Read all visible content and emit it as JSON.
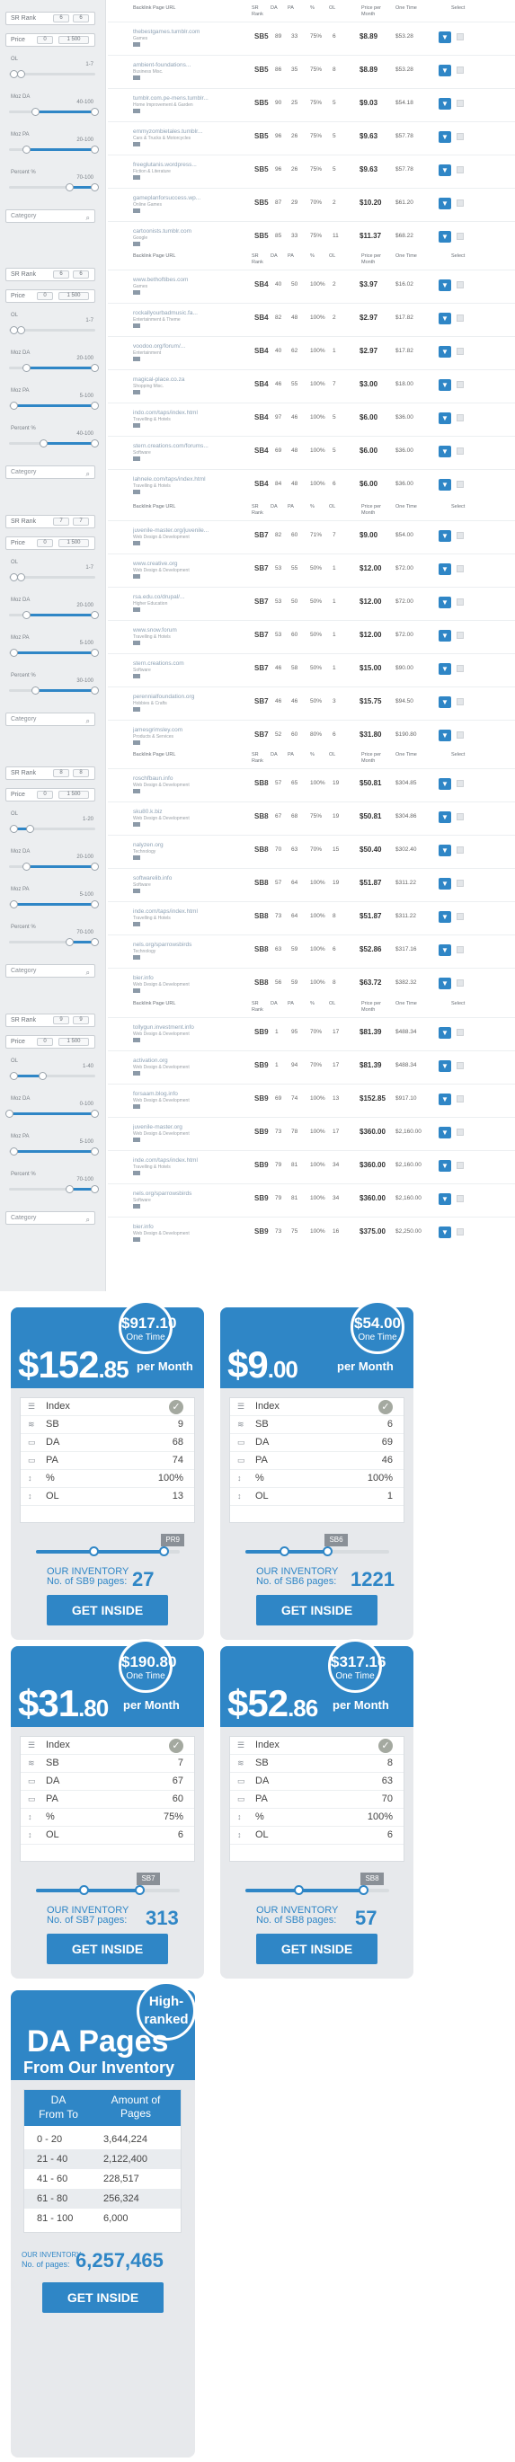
{
  "filters": {
    "sr_rank_label": "SR Rank",
    "price_label": "Price",
    "category_placeholder": "Category",
    "blocks": [
      {
        "sr_from": "6",
        "sr_to": "6",
        "price_from": "0",
        "price_to": "1 500",
        "ol": "1-7",
        "ol_min": 0.05,
        "ol_max": 0.15,
        "moz_da": "40-100",
        "moz_da_min": 0.3,
        "moz_da_max": 1.0,
        "moz_pa": "20-100",
        "moz_pa_min": 0.2,
        "moz_pa_max": 1.0,
        "percent": "70-100",
        "percent_min": 0.7,
        "percent_max": 1.0
      },
      {
        "sr_from": "6",
        "sr_to": "6",
        "price_from": "0",
        "price_to": "1 500",
        "ol": "1-7",
        "ol_min": 0.05,
        "ol_max": 0.15,
        "moz_da": "20-100",
        "moz_da_min": 0.2,
        "moz_da_max": 1.0,
        "moz_pa": "5-100",
        "moz_pa_min": 0.05,
        "moz_pa_max": 1.0,
        "percent": "40-100",
        "percent_min": 0.4,
        "percent_max": 1.0
      },
      {
        "sr_from": "7",
        "sr_to": "7",
        "price_from": "0",
        "price_to": "1 500",
        "ol": "1-7",
        "ol_min": 0.05,
        "ol_max": 0.15,
        "moz_da": "20-100",
        "moz_da_min": 0.2,
        "moz_da_max": 1.0,
        "moz_pa": "5-100",
        "moz_pa_min": 0.05,
        "moz_pa_max": 1.0,
        "percent": "30-100",
        "percent_min": 0.3,
        "percent_max": 1.0
      },
      {
        "sr_from": "8",
        "sr_to": "8",
        "price_from": "0",
        "price_to": "1 500",
        "ol": "1-20",
        "ol_min": 0.05,
        "ol_max": 0.25,
        "moz_da": "20-100",
        "moz_da_min": 0.2,
        "moz_da_max": 1.0,
        "moz_pa": "5-100",
        "moz_pa_min": 0.05,
        "moz_pa_max": 1.0,
        "percent": "70-100",
        "percent_min": 0.7,
        "percent_max": 1.0
      },
      {
        "sr_from": "9",
        "sr_to": "9",
        "price_from": "0",
        "price_to": "1 500",
        "ol": "1-40",
        "ol_min": 0.05,
        "ol_max": 0.4,
        "moz_da": "0-100",
        "moz_da_min": 0.0,
        "moz_da_max": 1.0,
        "moz_pa": "5-100",
        "moz_pa_min": 0.05,
        "moz_pa_max": 1.0,
        "percent": "70-100",
        "percent_min": 0.7,
        "percent_max": 1.0
      }
    ]
  },
  "table_header": {
    "page": "Backlink Page URL",
    "sr": "SR Rank",
    "da": "DA",
    "pa": "PA",
    "pct": "%",
    "ol": "OL",
    "price": "Price per Month",
    "one_time": "One Time",
    "select": "Select"
  },
  "tables": [
    {
      "rows": [
        {
          "site": "thebestgames.tumblr.com",
          "cat": "Games",
          "sr": "SB5",
          "da": "89",
          "pa": "33",
          "pct": "75%",
          "ol": "6",
          "pm": "$8.89",
          "ot": "$53.28"
        },
        {
          "site": "ambient-foundations...",
          "cat": "Business Misc.",
          "sr": "SB5",
          "da": "86",
          "pa": "35",
          "pct": "75%",
          "ol": "8",
          "pm": "$8.89",
          "ot": "$53.28"
        },
        {
          "site": "tumblr.com.pe-mens.tumblr...",
          "cat": "Home Improvement & Garden",
          "sr": "SB5",
          "da": "90",
          "pa": "25",
          "pct": "75%",
          "ol": "5",
          "pm": "$9.03",
          "ot": "$54.18"
        },
        {
          "site": "emmyzombietales.tumblr...",
          "cat": "Cars & Trucks & Motorcycles",
          "sr": "SB5",
          "da": "96",
          "pa": "26",
          "pct": "75%",
          "ol": "5",
          "pm": "$9.63",
          "ot": "$57.78"
        },
        {
          "site": "freeglutanis.wordpress...",
          "cat": "Fiction & Literature",
          "sr": "SB5",
          "da": "96",
          "pa": "26",
          "pct": "75%",
          "ol": "5",
          "pm": "$9.63",
          "ot": "$57.78"
        },
        {
          "site": "gameplanforsuccess.wp...",
          "cat": "Online Games",
          "sr": "SB5",
          "da": "87",
          "pa": "29",
          "pct": "70%",
          "ol": "2",
          "pm": "$10.20",
          "ot": "$61.20"
        },
        {
          "site": "cartoonists.tumblr.com",
          "cat": "Google",
          "sr": "SB5",
          "da": "85",
          "pa": "33",
          "pct": "75%",
          "ol": "11",
          "pm": "$11.37",
          "ot": "$68.22"
        }
      ]
    },
    {
      "rows": [
        {
          "site": "www.bethoftibes.com",
          "cat": "Games",
          "sr": "SB4",
          "da": "40",
          "pa": "50",
          "pct": "100%",
          "ol": "2",
          "pm": "$3.97",
          "ot": "$16.02"
        },
        {
          "site": "rockallyourbadmusic.fa...",
          "cat": "Entertainment & Theme",
          "sr": "SB4",
          "da": "82",
          "pa": "48",
          "pct": "100%",
          "ol": "2",
          "pm": "$2.97",
          "ot": "$17.82"
        },
        {
          "site": "voodoo.org/forum/...",
          "cat": "Entertainment",
          "sr": "SB4",
          "da": "40",
          "pa": "62",
          "pct": "100%",
          "ol": "1",
          "pm": "$2.97",
          "ot": "$17.82"
        },
        {
          "site": "magical-place.co.za",
          "cat": "Shopping Misc.",
          "sr": "SB4",
          "da": "46",
          "pa": "55",
          "pct": "100%",
          "ol": "7",
          "pm": "$3.00",
          "ot": "$18.00"
        },
        {
          "site": "indo.com/taps/index.html",
          "cat": "Travelling & Hotels",
          "sr": "SB4",
          "da": "97",
          "pa": "46",
          "pct": "100%",
          "ol": "5",
          "pm": "$6.00",
          "ot": "$36.00"
        },
        {
          "site": "stern.creations.com/forums...",
          "cat": "Software",
          "sr": "SB4",
          "da": "69",
          "pa": "48",
          "pct": "100%",
          "ol": "5",
          "pm": "$6.00",
          "ot": "$36.00"
        },
        {
          "site": "lahnele.com/taps/index.html",
          "cat": "Travelling & Hotels",
          "sr": "SB4",
          "da": "84",
          "pa": "48",
          "pct": "100%",
          "ol": "6",
          "pm": "$6.00",
          "ot": "$36.00"
        }
      ]
    },
    {
      "rows": [
        {
          "site": "juvenile-master.org/juvenile...",
          "cat": "Web Design & Development",
          "sr": "SB7",
          "da": "82",
          "pa": "60",
          "pct": "71%",
          "ol": "7",
          "pm": "$9.00",
          "ot": "$54.00"
        },
        {
          "site": "www.creative.org",
          "cat": "Web Design & Development",
          "sr": "SB7",
          "da": "53",
          "pa": "55",
          "pct": "50%",
          "ol": "1",
          "pm": "$12.00",
          "ot": "$72.00"
        },
        {
          "site": "rsa.edu.co/drupal/...",
          "cat": "Higher Education",
          "sr": "SB7",
          "da": "53",
          "pa": "50",
          "pct": "50%",
          "ol": "1",
          "pm": "$12.00",
          "ot": "$72.00"
        },
        {
          "site": "www.snow.forum",
          "cat": "Travelling & Hotels",
          "sr": "SB7",
          "da": "53",
          "pa": "60",
          "pct": "50%",
          "ol": "1",
          "pm": "$12.00",
          "ot": "$72.00"
        },
        {
          "site": "stern.creations.com",
          "cat": "Software",
          "sr": "SB7",
          "da": "46",
          "pa": "58",
          "pct": "50%",
          "ol": "1",
          "pm": "$15.00",
          "ot": "$90.00"
        },
        {
          "site": "perennialfoundation.org",
          "cat": "Hobbies & Crafts",
          "sr": "SB7",
          "da": "46",
          "pa": "46",
          "pct": "50%",
          "ol": "3",
          "pm": "$15.75",
          "ot": "$94.50"
        },
        {
          "site": "jamesgrimsley.com",
          "cat": "Products & Services",
          "sr": "SB7",
          "da": "52",
          "pa": "60",
          "pct": "80%",
          "ol": "6",
          "pm": "$31.80",
          "ot": "$190.80"
        }
      ]
    },
    {
      "rows": [
        {
          "site": "roschfbaun.info",
          "cat": "Web Design & Development",
          "sr": "SB8",
          "da": "57",
          "pa": "65",
          "pct": "100%",
          "ol": "19",
          "pm": "$50.81",
          "ot": "$304.85"
        },
        {
          "site": "sku80.k.biz",
          "cat": "Web Design & Development",
          "sr": "SB8",
          "da": "67",
          "pa": "68",
          "pct": "75%",
          "ol": "19",
          "pm": "$50.81",
          "ot": "$304.86"
        },
        {
          "site": "nalyzen.org",
          "cat": "Technology",
          "sr": "SB8",
          "da": "70",
          "pa": "63",
          "pct": "70%",
          "ol": "15",
          "pm": "$50.40",
          "ot": "$302.40"
        },
        {
          "site": "softwarelib.info",
          "cat": "Software",
          "sr": "SB8",
          "da": "57",
          "pa": "64",
          "pct": "100%",
          "ol": "19",
          "pm": "$51.87",
          "ot": "$311.22"
        },
        {
          "site": "inde.com/taps/index.html",
          "cat": "Travelling & Hotels",
          "sr": "SB8",
          "da": "73",
          "pa": "64",
          "pct": "100%",
          "ol": "8",
          "pm": "$51.87",
          "ot": "$311.22"
        },
        {
          "site": "nels.org/sparrowsbirds",
          "cat": "Technology",
          "sr": "SB8",
          "da": "63",
          "pa": "59",
          "pct": "100%",
          "ol": "6",
          "pm": "$52.86",
          "ot": "$317.16"
        },
        {
          "site": "bier.info",
          "cat": "Web Design & Development",
          "sr": "SB8",
          "da": "56",
          "pa": "59",
          "pct": "100%",
          "ol": "8",
          "pm": "$63.72",
          "ot": "$382.32"
        }
      ]
    },
    {
      "rows": [
        {
          "site": "tollygun.investment.info",
          "cat": "Web Design & Development",
          "sr": "SB9",
          "da": "1",
          "pa": "95",
          "pct": "70%",
          "ol": "17",
          "pm": "$81.39",
          "ot": "$488.34"
        },
        {
          "site": "activation.org",
          "cat": "Web Design & Development",
          "sr": "SB9",
          "da": "1",
          "pa": "94",
          "pct": "70%",
          "ol": "17",
          "pm": "$81.39",
          "ot": "$488.34"
        },
        {
          "site": "forsaam.blog.info",
          "cat": "Web Design & Development",
          "sr": "SB9",
          "da": "69",
          "pa": "74",
          "pct": "100%",
          "ol": "13",
          "pm": "$152.85",
          "ot": "$917.10"
        },
        {
          "site": "juvenile-master.org",
          "cat": "Web Design & Development",
          "sr": "SB9",
          "da": "73",
          "pa": "78",
          "pct": "100%",
          "ol": "17",
          "pm": "$360.00",
          "ot": "$2,160.00"
        },
        {
          "site": "inde.com/taps/index.html",
          "cat": "Travelling & Hotels",
          "sr": "SB9",
          "da": "79",
          "pa": "81",
          "pct": "100%",
          "ol": "34",
          "pm": "$360.00",
          "ot": "$2,160.00"
        },
        {
          "site": "nels.org/sparrowsbirds",
          "cat": "Software",
          "sr": "SB9",
          "da": "79",
          "pa": "81",
          "pct": "100%",
          "ol": "34",
          "pm": "$360.00",
          "ot": "$2,160.00"
        },
        {
          "site": "bier.info",
          "cat": "Web Design & Development",
          "sr": "SB9",
          "da": "73",
          "pa": "75",
          "pct": "100%",
          "ol": "16",
          "pm": "$375.00",
          "ot": "$2,250.00"
        }
      ]
    }
  ],
  "cards": [
    {
      "one_time": "$917.10",
      "one_time_label": "One Time",
      "price_big": "$152",
      "price_cents": ".85",
      "per_month": "per Month",
      "index_label": "Index",
      "sb_label": "SB",
      "sb": "9",
      "da_label": "DA",
      "da": "68",
      "pa_label": "PA",
      "pa": "74",
      "pct_label": "%",
      "pct": "100%",
      "ol_label": "OL",
      "ol": "13",
      "tag": "PR9",
      "slider": 0.92,
      "inv1": "OUR INVENTORY",
      "inv2": "No. of SB9 pages:",
      "count": "27",
      "button": "GET INSIDE"
    },
    {
      "one_time": "$54.00",
      "one_time_label": "One Time",
      "price_big": "$9",
      "price_cents": ".00",
      "per_month": "per Month",
      "index_label": "Index",
      "sb_label": "SB",
      "sb": "6",
      "da_label": "DA",
      "da": "69",
      "pa_label": "PA",
      "pa": "46",
      "pct_label": "%",
      "pct": "100%",
      "ol_label": "OL",
      "ol": "1",
      "tag": "SB6",
      "slider": 0.6,
      "inv1": "OUR INVENTORY",
      "inv2": "No. of SB6 pages:",
      "count": "1221",
      "button": "GET INSIDE"
    },
    {
      "one_time": "$190.80",
      "one_time_label": "One Time",
      "price_big": "$31",
      "price_cents": ".80",
      "per_month": "per Month",
      "index_label": "Index",
      "sb_label": "SB",
      "sb": "7",
      "da_label": "DA",
      "da": "67",
      "pa_label": "PA",
      "pa": "60",
      "pct_label": "%",
      "pct": "75%",
      "ol_label": "OL",
      "ol": "6",
      "tag": "SB7",
      "slider": 0.75,
      "inv1": "OUR INVENTORY",
      "inv2": "No. of SB7 pages:",
      "count": "313",
      "button": "GET INSIDE"
    },
    {
      "one_time": "$317.16",
      "one_time_label": "One Time",
      "price_big": "$52",
      "price_cents": ".86",
      "per_month": "per Month",
      "index_label": "Index",
      "sb_label": "SB",
      "sb": "8",
      "da_label": "DA",
      "da": "63",
      "pa_label": "PA",
      "pa": "70",
      "pct_label": "%",
      "pct": "100%",
      "ol_label": "OL",
      "ol": "6",
      "tag": "SB8",
      "slider": 0.85,
      "inv1": "OUR INVENTORY",
      "inv2": "No. of SB8 pages:",
      "count": "57",
      "button": "GET INSIDE"
    }
  ],
  "da_card": {
    "badge": "High-ranked",
    "title1": "DA Pages",
    "title2": "From Our Inventory",
    "col1": "DA",
    "col1b": "From  To",
    "col2": "Amount of Pages",
    "rows": [
      {
        "range": "0  -  20",
        "amount": "3,644,224"
      },
      {
        "range": "21  -  40",
        "amount": "2,122,400"
      },
      {
        "range": "41  -  60",
        "amount": "228,517"
      },
      {
        "range": "61  -  80",
        "amount": "256,324"
      },
      {
        "range": "81  -  100",
        "amount": "6,000"
      }
    ],
    "inv1": "OUR INVENTORY",
    "inv2": "No. of pages:",
    "total": "6,257,465",
    "button": "GET INSIDE"
  },
  "colors": {
    "accent": "#2f86c6",
    "panel": "#e7e9ec"
  }
}
